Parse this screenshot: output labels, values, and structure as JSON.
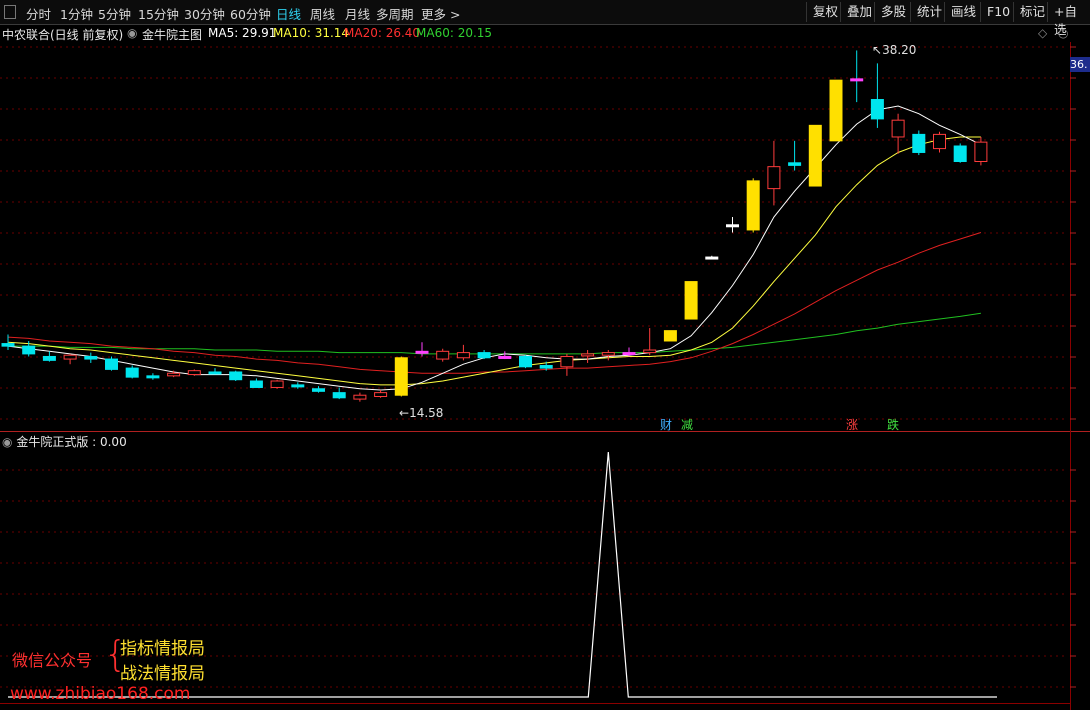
{
  "toolbar": {
    "periods": [
      {
        "label": "分时"
      },
      {
        "label": "1分钟"
      },
      {
        "label": "5分钟"
      },
      {
        "label": "15分钟"
      },
      {
        "label": "30分钟"
      },
      {
        "label": "60分钟"
      },
      {
        "label": "日线",
        "active": true
      },
      {
        "label": "周线"
      },
      {
        "label": "月线"
      },
      {
        "label": "多周期"
      },
      {
        "label": "更多 >"
      }
    ],
    "right_buttons": [
      "复权",
      "叠加",
      "多股",
      "统计",
      "画线",
      "F10",
      "标记",
      "+自选"
    ]
  },
  "info": {
    "stock_name": "中农联合(日线 前复权)",
    "indicator_name": "金牛院主图",
    "ma5": "MA5: 29.91",
    "ma10": "MA10: 31.14",
    "ma20": "MA20: 26.40",
    "ma60": "MA60: 20.15"
  },
  "price_labels": {
    "high": "38.20",
    "low": "14.58",
    "right_axis": "36."
  },
  "event_markers": [
    {
      "text": "财",
      "color": "#40b0ff"
    },
    {
      "text": "减",
      "color": "#40e040"
    },
    {
      "text": "涨",
      "color": "#ff4040"
    },
    {
      "text": "跌",
      "color": "#40e040"
    }
  ],
  "sub_panel": {
    "title": "金牛院正式版 : 0.00"
  },
  "watermark": {
    "label": "微信公众号",
    "line1": "指标情报局",
    "line2": "战法情报局",
    "url": "www.zhibiao168.com"
  },
  "colors": {
    "up": "#ff3c3c",
    "down": "#00e5ee",
    "limit_up": "#ffe000",
    "ma5": "#ffffff",
    "ma10": "#ffff40",
    "ma20": "#e02020",
    "ma60": "#20c020",
    "grid": "#6a0000"
  },
  "chart_data": {
    "type": "candlestick",
    "price_range": [
      12.5,
      41.0
    ],
    "candles": [
      {
        "o": 17.8,
        "h": 18.5,
        "l": 17.3,
        "c": 17.6,
        "t": "down"
      },
      {
        "o": 17.6,
        "h": 18.0,
        "l": 16.8,
        "c": 17.0,
        "t": "down"
      },
      {
        "o": 16.8,
        "h": 17.2,
        "l": 16.4,
        "c": 16.5,
        "t": "down"
      },
      {
        "o": 16.6,
        "h": 17.0,
        "l": 16.2,
        "c": 16.9,
        "t": "up"
      },
      {
        "o": 16.8,
        "h": 17.1,
        "l": 16.3,
        "c": 16.6,
        "t": "down"
      },
      {
        "o": 16.6,
        "h": 16.8,
        "l": 15.7,
        "c": 15.8,
        "t": "down"
      },
      {
        "o": 15.9,
        "h": 16.1,
        "l": 15.1,
        "c": 15.2,
        "t": "down"
      },
      {
        "o": 15.2,
        "h": 15.5,
        "l": 15.0,
        "c": 15.3,
        "t": "down"
      },
      {
        "o": 15.3,
        "h": 15.7,
        "l": 15.2,
        "c": 15.5,
        "t": "up"
      },
      {
        "o": 15.4,
        "h": 15.8,
        "l": 15.3,
        "c": 15.7,
        "t": "up"
      },
      {
        "o": 15.6,
        "h": 15.9,
        "l": 15.4,
        "c": 15.5,
        "t": "down"
      },
      {
        "o": 15.6,
        "h": 15.7,
        "l": 14.9,
        "c": 15.0,
        "t": "down"
      },
      {
        "o": 14.9,
        "h": 15.1,
        "l": 14.4,
        "c": 14.4,
        "t": "down"
      },
      {
        "o": 14.4,
        "h": 15.0,
        "l": 14.3,
        "c": 14.9,
        "t": "up"
      },
      {
        "o": 14.6,
        "h": 14.8,
        "l": 14.3,
        "c": 14.5,
        "t": "down"
      },
      {
        "o": 14.3,
        "h": 14.5,
        "l": 14.0,
        "c": 14.1,
        "t": "down"
      },
      {
        "o": 14.0,
        "h": 14.4,
        "l": 13.5,
        "c": 13.6,
        "t": "down"
      },
      {
        "o": 13.5,
        "h": 14.0,
        "l": 13.3,
        "c": 13.8,
        "t": "up"
      },
      {
        "o": 13.7,
        "h": 14.2,
        "l": 13.6,
        "c": 14.0,
        "t": "up"
      },
      {
        "o": 13.8,
        "h": 16.8,
        "l": 13.7,
        "c": 16.7,
        "t": "limit"
      },
      {
        "o": 17.2,
        "h": 17.9,
        "l": 16.8,
        "c": 17.2,
        "t": "doji"
      },
      {
        "o": 16.6,
        "h": 17.4,
        "l": 16.4,
        "c": 17.2,
        "t": "up"
      },
      {
        "o": 16.7,
        "h": 17.7,
        "l": 16.5,
        "c": 17.1,
        "t": "up"
      },
      {
        "o": 17.1,
        "h": 17.3,
        "l": 16.6,
        "c": 16.7,
        "t": "down"
      },
      {
        "o": 16.8,
        "h": 17.2,
        "l": 16.6,
        "c": 16.8,
        "t": "doji"
      },
      {
        "o": 16.8,
        "h": 16.9,
        "l": 15.9,
        "c": 16.0,
        "t": "down"
      },
      {
        "o": 15.9,
        "h": 16.4,
        "l": 15.7,
        "c": 16.1,
        "t": "down"
      },
      {
        "o": 16.0,
        "h": 17.0,
        "l": 15.3,
        "c": 16.8,
        "t": "up"
      },
      {
        "o": 16.9,
        "h": 17.3,
        "l": 16.3,
        "c": 17.0,
        "t": "up"
      },
      {
        "o": 16.9,
        "h": 17.3,
        "l": 16.5,
        "c": 17.1,
        "t": "up"
      },
      {
        "o": 17.1,
        "h": 17.5,
        "l": 16.8,
        "c": 17.1,
        "t": "doji"
      },
      {
        "o": 17.1,
        "h": 19.0,
        "l": 16.9,
        "c": 17.3,
        "t": "up"
      },
      {
        "o": 18.0,
        "h": 18.8,
        "l": 18.0,
        "c": 18.8,
        "t": "limit"
      },
      {
        "o": 19.7,
        "h": 22.6,
        "l": 19.7,
        "c": 22.6,
        "t": "limit"
      },
      {
        "o": 24.5,
        "h": 24.6,
        "l": 24.4,
        "c": 24.5,
        "t": "flat"
      },
      {
        "o": 27.0,
        "h": 27.6,
        "l": 26.4,
        "c": 27.0,
        "t": "flat"
      },
      {
        "o": 26.6,
        "h": 30.6,
        "l": 26.4,
        "c": 30.4,
        "t": "limit"
      },
      {
        "o": 29.8,
        "h": 33.5,
        "l": 28.5,
        "c": 31.5,
        "t": "up"
      },
      {
        "o": 31.8,
        "h": 33.5,
        "l": 31.2,
        "c": 31.6,
        "t": "down"
      },
      {
        "o": 30.0,
        "h": 34.7,
        "l": 30.0,
        "c": 34.7,
        "t": "limit"
      },
      {
        "o": 33.5,
        "h": 38.2,
        "l": 33.5,
        "c": 38.2,
        "t": "limit"
      },
      {
        "o": 38.3,
        "h": 40.5,
        "l": 36.5,
        "c": 38.3,
        "t": "flat"
      },
      {
        "o": 36.7,
        "h": 39.5,
        "l": 34.5,
        "c": 35.2,
        "t": "down"
      },
      {
        "o": 33.8,
        "h": 35.6,
        "l": 32.5,
        "c": 35.1,
        "t": "up"
      },
      {
        "o": 34.0,
        "h": 34.3,
        "l": 32.4,
        "c": 32.6,
        "t": "down"
      },
      {
        "o": 32.9,
        "h": 34.2,
        "l": 32.6,
        "c": 34.0,
        "t": "up"
      },
      {
        "o": 33.1,
        "h": 33.3,
        "l": 31.8,
        "c": 31.9,
        "t": "down"
      },
      {
        "o": 31.9,
        "h": 33.8,
        "l": 31.6,
        "c": 33.4,
        "t": "up"
      }
    ],
    "ma5": [
      17.6,
      17.4,
      17.2,
      17.0,
      16.8,
      16.5,
      16.2,
      15.9,
      15.6,
      15.4,
      15.4,
      15.4,
      15.3,
      15.1,
      14.9,
      14.7,
      14.5,
      14.3,
      14.2,
      14.3,
      14.8,
      15.5,
      16.2,
      16.7,
      17.0,
      16.9,
      16.7,
      16.6,
      16.6,
      16.8,
      16.9,
      17.1,
      17.4,
      18.4,
      20.2,
      22.3,
      24.7,
      27.6,
      29.6,
      31.4,
      33.2,
      34.8,
      35.9,
      36.2,
      35.6,
      34.7,
      34.0,
      33.2
    ],
    "ma10": [
      17.9,
      17.8,
      17.6,
      17.4,
      17.3,
      17.1,
      16.9,
      16.7,
      16.5,
      16.3,
      16.1,
      15.9,
      15.7,
      15.5,
      15.3,
      15.1,
      14.9,
      14.7,
      14.6,
      14.6,
      14.7,
      14.9,
      15.2,
      15.5,
      15.8,
      16.1,
      16.3,
      16.5,
      16.6,
      16.7,
      16.8,
      16.8,
      16.9,
      17.3,
      17.9,
      19.0,
      20.7,
      22.6,
      24.4,
      26.2,
      28.4,
      30.1,
      31.6,
      32.6,
      33.2,
      33.6,
      33.8,
      33.8
    ],
    "ma20": [
      18.3,
      18.2,
      18.0,
      17.9,
      17.8,
      17.6,
      17.5,
      17.4,
      17.2,
      17.1,
      16.9,
      16.8,
      16.6,
      16.5,
      16.3,
      16.2,
      16.0,
      15.8,
      15.7,
      15.6,
      15.5,
      15.5,
      15.5,
      15.6,
      15.6,
      15.7,
      15.8,
      15.9,
      15.9,
      16.0,
      16.1,
      16.2,
      16.4,
      16.7,
      17.2,
      17.8,
      18.5,
      19.3,
      20.1,
      21.0,
      21.9,
      22.7,
      23.5,
      24.1,
      24.8,
      25.4,
      25.9,
      26.4
    ],
    "ma60": [
      17.6,
      17.6,
      17.6,
      17.5,
      17.5,
      17.5,
      17.4,
      17.4,
      17.4,
      17.4,
      17.3,
      17.3,
      17.3,
      17.2,
      17.2,
      17.2,
      17.1,
      17.1,
      17.1,
      17.1,
      17.0,
      17.0,
      17.0,
      17.0,
      17.0,
      17.0,
      17.0,
      17.0,
      17.0,
      17.1,
      17.1,
      17.1,
      17.2,
      17.3,
      17.4,
      17.5,
      17.7,
      17.9,
      18.1,
      18.3,
      18.5,
      18.8,
      19.0,
      19.3,
      19.5,
      19.7,
      19.9,
      20.15
    ],
    "sub_series": {
      "peak_index": 29,
      "peak_value": 1.0,
      "baseline": 0.0
    }
  }
}
